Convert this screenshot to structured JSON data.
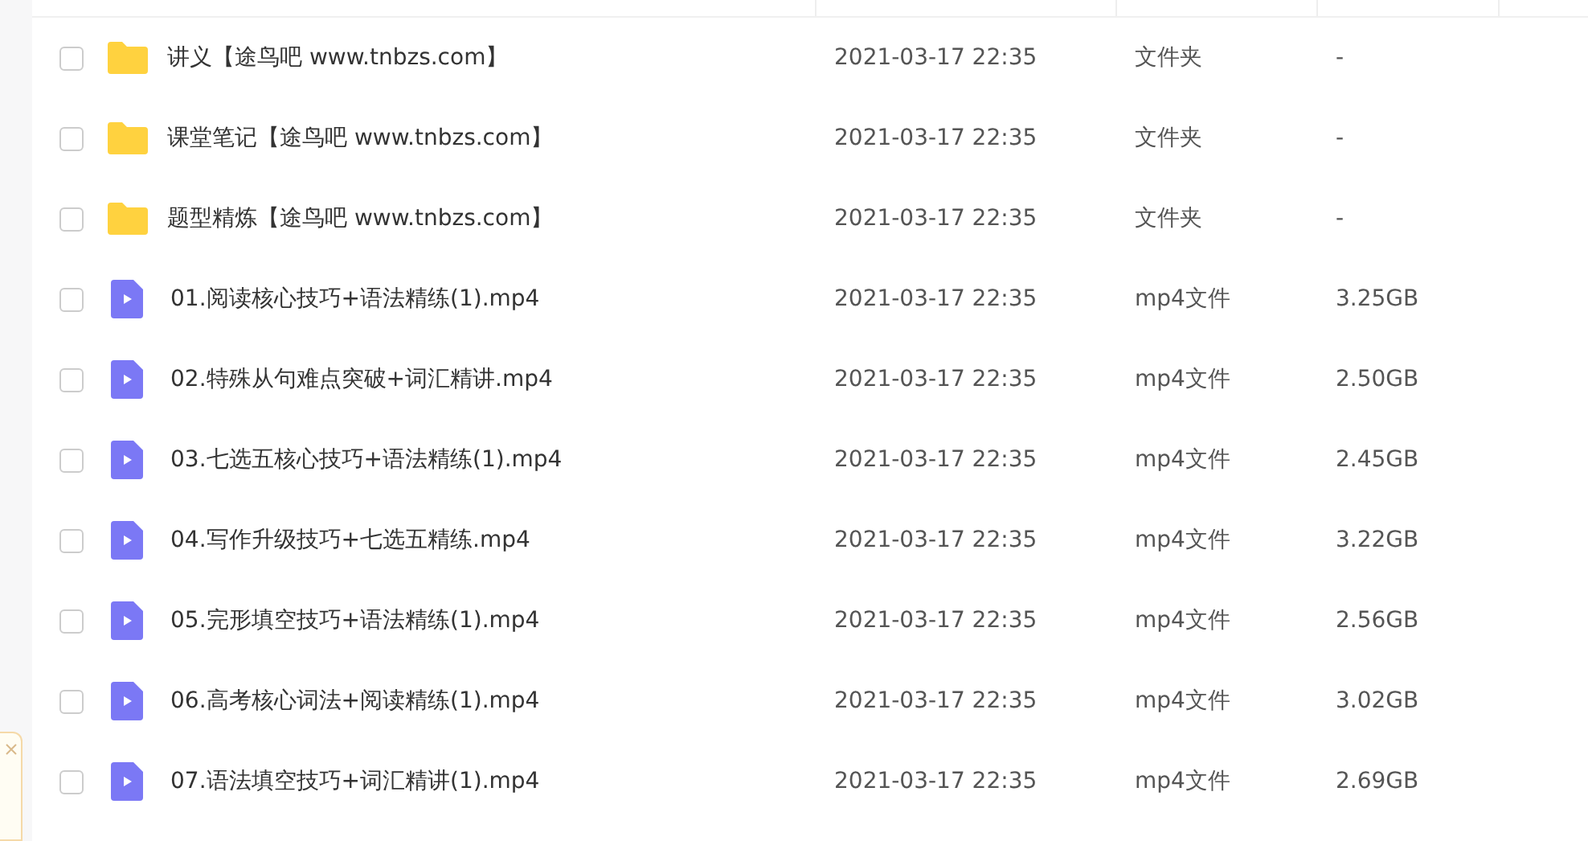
{
  "files": [
    {
      "kind": "folder",
      "name": "讲义【途鸟吧 www.tnbzs.com】",
      "date": "2021-03-17 22:35",
      "type": "文件夹",
      "size": "-",
      "checked": false
    },
    {
      "kind": "folder",
      "name": "课堂笔记【途鸟吧 www.tnbzs.com】",
      "date": "2021-03-17 22:35",
      "type": "文件夹",
      "size": "-",
      "checked": false
    },
    {
      "kind": "folder",
      "name": "题型精炼【途鸟吧 www.tnbzs.com】",
      "date": "2021-03-17 22:35",
      "type": "文件夹",
      "size": "-",
      "checked": false
    },
    {
      "kind": "video",
      "name": "01.阅读核心技巧+语法精练(1).mp4",
      "date": "2021-03-17 22:35",
      "type": "mp4文件",
      "size": "3.25GB",
      "checked": false
    },
    {
      "kind": "video",
      "name": "02.特殊从句难点突破+词汇精讲.mp4",
      "date": "2021-03-17 22:35",
      "type": "mp4文件",
      "size": "2.50GB",
      "checked": false
    },
    {
      "kind": "video",
      "name": "03.七选五核心技巧+语法精练(1).mp4",
      "date": "2021-03-17 22:35",
      "type": "mp4文件",
      "size": "2.45GB",
      "checked": false
    },
    {
      "kind": "video",
      "name": "04.写作升级技巧+七选五精练.mp4",
      "date": "2021-03-17 22:35",
      "type": "mp4文件",
      "size": "3.22GB",
      "checked": false
    },
    {
      "kind": "video",
      "name": "05.完形填空技巧+语法精练(1).mp4",
      "date": "2021-03-17 22:35",
      "type": "mp4文件",
      "size": "2.56GB",
      "checked": false
    },
    {
      "kind": "video",
      "name": "06.高考核心词法+阅读精练(1).mp4",
      "date": "2021-03-17 22:35",
      "type": "mp4文件",
      "size": "3.02GB",
      "checked": false
    },
    {
      "kind": "video",
      "name": "07.语法填空技巧+词汇精讲(1).mp4",
      "date": "2021-03-17 22:35",
      "type": "mp4文件",
      "size": "2.69GB",
      "checked": false
    }
  ]
}
